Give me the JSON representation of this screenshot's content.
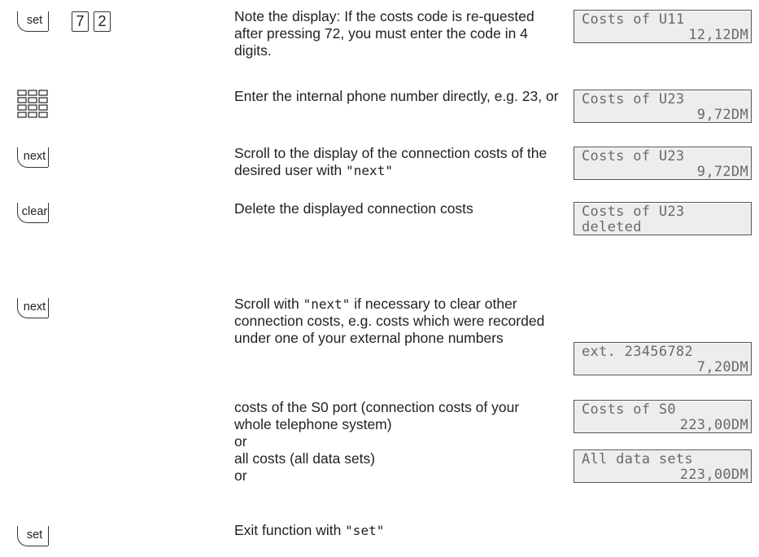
{
  "steps": [
    {
      "keys": [
        "set",
        "7",
        "2"
      ],
      "text": "Note the display: If the costs code is re-quested after pressing 72, you must enter the code in 4 digits.",
      "lcd": {
        "line1": "Costs of U11",
        "line2": "12,12DM"
      }
    },
    {
      "icon": "keypad-icon",
      "text": "Enter the internal phone number directly, e.g. 23, or",
      "lcd": {
        "line1": "Costs of U23",
        "line2": "9,72DM"
      }
    },
    {
      "keys": [
        "next"
      ],
      "text_before": "Scroll to the display of the connection costs of the desired user with ",
      "text_quoted": "\"next\"",
      "lcd": {
        "line1": "Costs of U23",
        "line2": "9,72DM"
      }
    },
    {
      "keys": [
        "clear"
      ],
      "text": "Delete the displayed connection costs",
      "lcd": {
        "line1": "Costs of U23",
        "line2": "deleted"
      }
    },
    {
      "keys": [
        "next"
      ],
      "text_before": "Scroll with ",
      "text_quoted": "\"next\"",
      "text_after": " if necessary to clear other connection costs, e.g. costs which were recorded under one of your external phone numbers",
      "lcd": {
        "line1": "ext. 23456782",
        "line2": "7,20DM"
      }
    },
    {
      "text": "costs of the S0 port (connection costs of your whole telephone system)",
      "or": "or",
      "lcd": {
        "line1": "Costs of S0",
        "line2": "223,00DM"
      }
    },
    {
      "text": "all costs (all data sets)",
      "or": "or",
      "lcd": {
        "line1": "All data sets",
        "line2": "223,00DM"
      }
    },
    {
      "keys": [
        "set"
      ],
      "text_before": "Exit function with ",
      "text_quoted": "\"set\""
    }
  ]
}
